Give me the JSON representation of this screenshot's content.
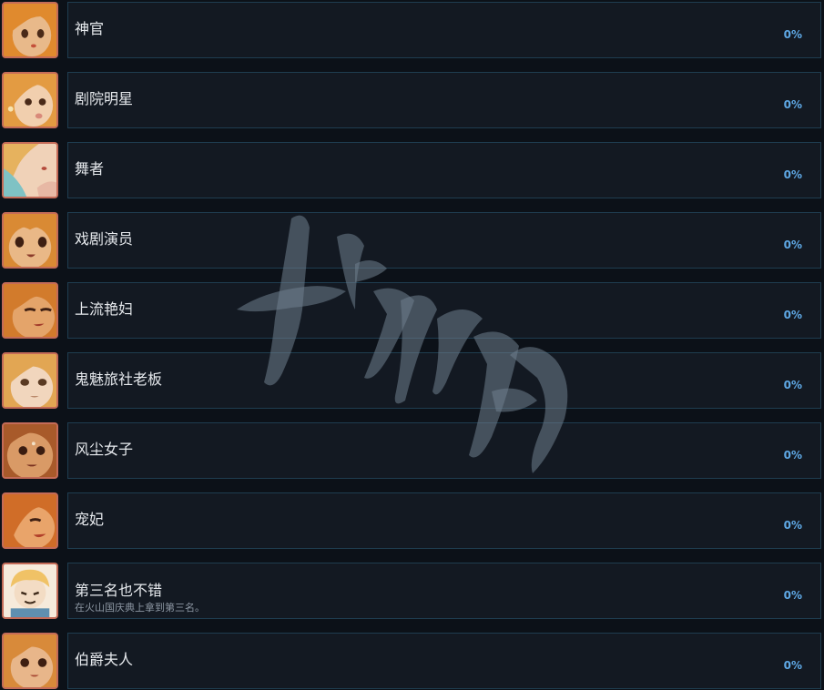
{
  "achievements": [
    {
      "title": "神官",
      "description": "",
      "percent": "0%",
      "skin": "#e8b98a",
      "hair": "#e08a2e",
      "accent": "#c4503a"
    },
    {
      "title": "剧院明星",
      "description": "",
      "percent": "0%",
      "skin": "#f1cfae",
      "hair": "#e39b42",
      "accent": "#d98a7a"
    },
    {
      "title": "舞者",
      "description": "",
      "percent": "0%",
      "skin": "#f0d2b8",
      "hair": "#e6b25e",
      "accent": "#b54b3c"
    },
    {
      "title": "戏剧演员",
      "description": "",
      "percent": "0%",
      "skin": "#e9b887",
      "hair": "#d98a34",
      "accent": "#8a3a2a"
    },
    {
      "title": "上流艳妇",
      "description": "",
      "percent": "0%",
      "skin": "#e4a46a",
      "hair": "#d27b2c",
      "accent": "#a33b2a"
    },
    {
      "title": "鬼魅旅社老板",
      "description": "",
      "percent": "0%",
      "skin": "#f1d6bd",
      "hair": "#e2a653",
      "accent": "#9a5b3a"
    },
    {
      "title": "风尘女子",
      "description": "",
      "percent": "0%",
      "skin": "#d99a66",
      "hair": "#a85a2a",
      "accent": "#7a3220"
    },
    {
      "title": "宠妃",
      "description": "",
      "percent": "0%",
      "skin": "#e9a46a",
      "hair": "#d06d28",
      "accent": "#b2402a"
    },
    {
      "title": "第三名也不错",
      "description": "在火山国庆典上拿到第三名。",
      "percent": "0%",
      "skin": "#f3dcc4",
      "hair": "#f0c266",
      "accent": "#5f8fb0"
    },
    {
      "title": "伯爵夫人",
      "description": "",
      "percent": "0%",
      "skin": "#e8b68a",
      "hair": "#d88a3a",
      "accent": "#a84a35"
    }
  ],
  "watermark": {
    "text": "游侠网"
  },
  "colors": {
    "page_background": "#0c1118",
    "panel_background": "#131922",
    "panel_border": "#1f3d50",
    "title": "#e6e9ed",
    "description": "#8d97a3",
    "percent": "#5fa9e6",
    "avatar_border": "#c46b58"
  }
}
